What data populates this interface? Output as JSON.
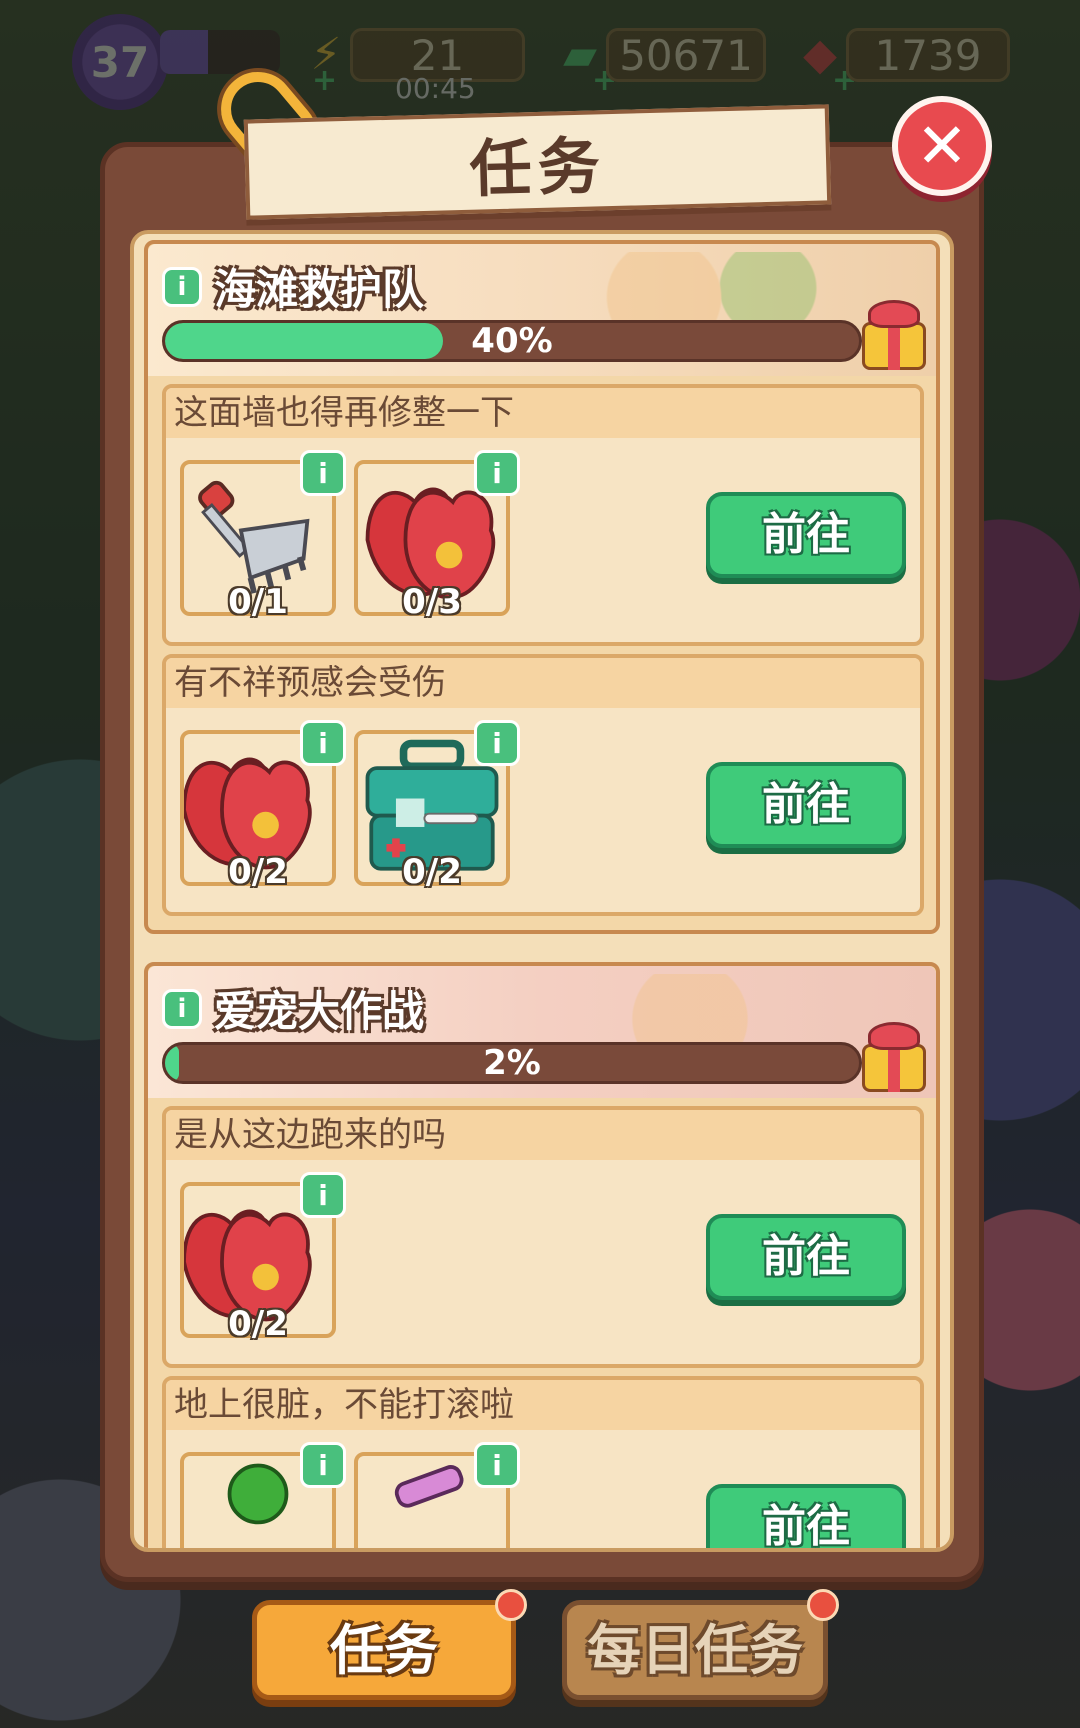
{
  "hud": {
    "level": "37",
    "xp_progress": 0.4,
    "energy": "21",
    "energy_timer": "00:45",
    "cash": "50671",
    "gems": "1739",
    "energy_icon": "lightning-icon",
    "cash_icon": "cash-icon",
    "gem_icon": "ruby-icon"
  },
  "panel": {
    "title": "任务",
    "close_icon": "close-icon"
  },
  "groups": [
    {
      "title": "海滩救护队",
      "progress_label": "40%",
      "progress": 0.4,
      "quests": [
        {
          "title": "这面墙也得再修整一下",
          "items": [
            {
              "icon": "rake-icon",
              "count": "0/1"
            },
            {
              "icon": "red-gloves-icon",
              "count": "0/3"
            }
          ],
          "button": "前往"
        },
        {
          "title": "有不祥预感会受伤",
          "items": [
            {
              "icon": "red-gloves-icon",
              "count": "0/2"
            },
            {
              "icon": "first-aid-kit-icon",
              "count": "0/2"
            }
          ],
          "button": "前往"
        }
      ]
    },
    {
      "title": "爱宠大作战",
      "progress_label": "2%",
      "progress": 0.02,
      "quests": [
        {
          "title": "是从这边跑来的吗",
          "items": [
            {
              "icon": "red-gloves-icon",
              "count": "0/2"
            }
          ],
          "button": "前往"
        },
        {
          "title": "地上很脏，不能打滚啦",
          "items": [
            {
              "icon": "green-plant-icon",
              "count": ""
            },
            {
              "icon": "pink-tool-icon",
              "count": ""
            }
          ],
          "button": "前往"
        }
      ]
    }
  ],
  "tabs": {
    "active": "任务",
    "inactive": "每日任务"
  },
  "colors": {
    "accent_green": "#3fcb7a",
    "progress_green": "#4fd68b",
    "panel_brown": "#7a4a38",
    "tab_orange": "#f6a83a",
    "close_red": "#e84a4f"
  }
}
